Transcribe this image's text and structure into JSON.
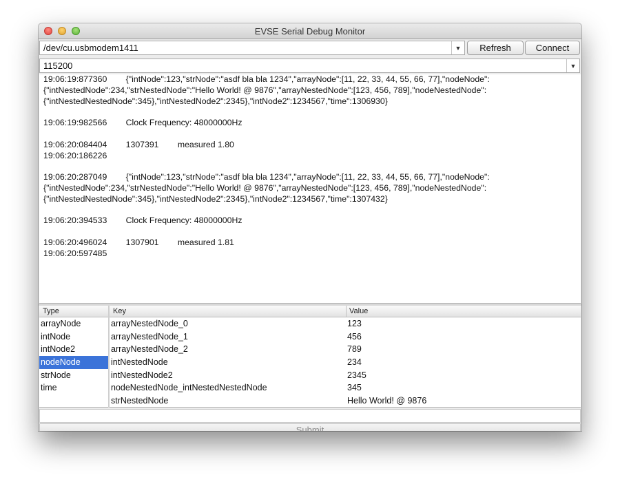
{
  "window": {
    "title": "EVSE Serial Debug Monitor"
  },
  "connection": {
    "port_value": "/dev/cu.usbmodem1411",
    "refresh_label": "Refresh",
    "connect_label": "Connect",
    "baud_value": "115200"
  },
  "log": {
    "lines": [
      "19:06:19:877360        {\"intNode\":123,\"strNode\":\"asdf bla bla 1234\",\"arrayNode\":[11, 22, 33, 44, 55, 66, 77],\"nodeNode\":",
      "{\"intNestedNode\":234,\"strNestedNode\":\"Hello World! @ 9876\",\"arrayNestedNode\":[123, 456, 789],\"nodeNestedNode\":",
      "{\"intNestedNestedNode\":345},\"intNestedNode2\":2345},\"intNode2\":1234567,\"time\":1306930}",
      "",
      "19:06:19:982566        Clock Frequency: 48000000Hz",
      "",
      "19:06:20:084404        1307391        measured 1.80",
      "19:06:20:186226",
      "",
      "19:06:20:287049        {\"intNode\":123,\"strNode\":\"asdf bla bla 1234\",\"arrayNode\":[11, 22, 33, 44, 55, 66, 77],\"nodeNode\":",
      "{\"intNestedNode\":234,\"strNestedNode\":\"Hello World! @ 9876\",\"arrayNestedNode\":[123, 456, 789],\"nodeNestedNode\":",
      "{\"intNestedNestedNode\":345},\"intNestedNode2\":2345},\"intNode2\":1234567,\"time\":1307432}",
      "",
      "19:06:20:394533        Clock Frequency: 48000000Hz",
      "",
      "19:06:20:496024        1307901        measured 1.81",
      "19:06:20:597485"
    ]
  },
  "type_table": {
    "header": "Type",
    "items": [
      "arrayNode",
      "intNode",
      "intNode2",
      "nodeNode",
      "strNode",
      "time"
    ],
    "selected": "nodeNode"
  },
  "kv_table": {
    "key_header": "Key",
    "value_header": "Value",
    "rows": [
      {
        "key": "arrayNestedNode_0",
        "value": "123"
      },
      {
        "key": "arrayNestedNode_1",
        "value": "456"
      },
      {
        "key": "arrayNestedNode_2",
        "value": "789"
      },
      {
        "key": "intNestedNode",
        "value": "234"
      },
      {
        "key": "intNestedNode2",
        "value": "2345"
      },
      {
        "key": "nodeNestedNode_intNestedNestedNode",
        "value": "345"
      },
      {
        "key": "strNestedNode",
        "value": "Hello World! @ 9876"
      }
    ]
  },
  "input": {
    "value": ""
  },
  "submit": {
    "label": "Submit"
  },
  "colors": {
    "selection": "#3b73d9",
    "submit_text": "#8a8a8a"
  }
}
